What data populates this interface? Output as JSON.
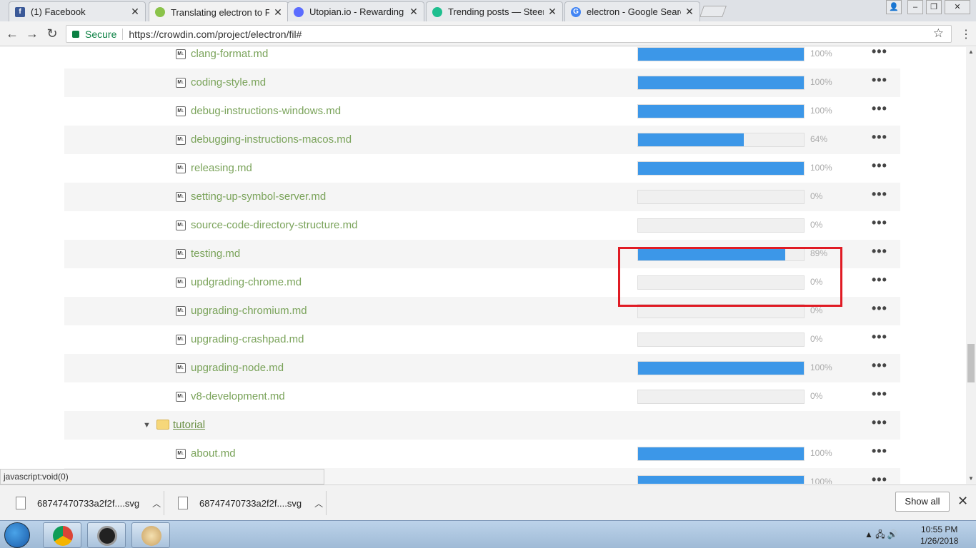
{
  "browser": {
    "tabs": [
      {
        "title": "(1) Facebook",
        "favicon": "facebook-icon",
        "color": "#3b5998"
      },
      {
        "title": "Translating electron to Fr",
        "favicon": "crowdin-icon",
        "color": "#8bc34a",
        "active": true
      },
      {
        "title": "Utopian.io - Rewarding O",
        "favicon": "utopian-icon",
        "color": "#5b6cff"
      },
      {
        "title": "Trending posts — Steem",
        "favicon": "steemit-icon",
        "color": "#1fbf8f"
      },
      {
        "title": "electron - Google Search",
        "favicon": "google-icon",
        "color": "#4285f4"
      }
    ],
    "secure_label": "Secure",
    "url": "https://crowdin.com/project/electron/fil#"
  },
  "files": [
    {
      "name": "clang-format.md",
      "percent": 100,
      "label": "100%"
    },
    {
      "name": "coding-style.md",
      "percent": 100,
      "label": "100%"
    },
    {
      "name": "debug-instructions-windows.md",
      "percent": 100,
      "label": "100%"
    },
    {
      "name": "debugging-instructions-macos.md",
      "percent": 64,
      "label": "64%"
    },
    {
      "name": "releasing.md",
      "percent": 100,
      "label": "100%"
    },
    {
      "name": "setting-up-symbol-server.md",
      "percent": 0,
      "label": "0%"
    },
    {
      "name": "source-code-directory-structure.md",
      "percent": 0,
      "label": "0%"
    },
    {
      "name": "testing.md",
      "percent": 89,
      "label": "89%"
    },
    {
      "name": "updgrading-chrome.md",
      "percent": 0,
      "label": "0%"
    },
    {
      "name": "upgrading-chromium.md",
      "percent": 0,
      "label": "0%"
    },
    {
      "name": "upgrading-crashpad.md",
      "percent": 0,
      "label": "0%"
    },
    {
      "name": "upgrading-node.md",
      "percent": 100,
      "label": "100%"
    },
    {
      "name": "v8-development.md",
      "percent": 0,
      "label": "0%"
    }
  ],
  "folder": {
    "name": "tutorial"
  },
  "tutorial_files": [
    {
      "name": "about.md",
      "percent": 100,
      "label": "100%"
    },
    {
      "name": "",
      "percent": 100,
      "label": "100%"
    }
  ],
  "status_text": "javascript:void(0)",
  "downloads": [
    {
      "name": "68747470733a2f2f....svg"
    },
    {
      "name": "68747470733a2f2f....svg"
    }
  ],
  "show_all_label": "Show all",
  "clock": {
    "time": "10:55 PM",
    "date": "1/26/2018"
  },
  "icons": {
    "md": "M↓",
    "dots": "•••"
  }
}
